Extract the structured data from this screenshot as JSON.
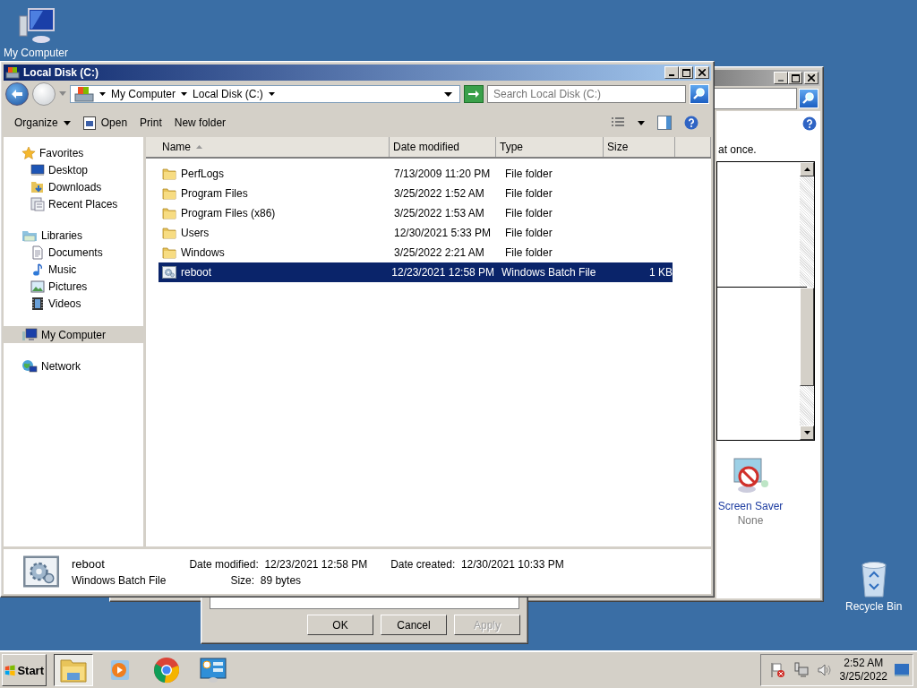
{
  "desktop_icons": [
    {
      "label": "My Computer"
    },
    {
      "label": "Recycle Bin"
    }
  ],
  "background_window": {
    "text_fragment": "at once.",
    "screen_saver": {
      "label": "Screen Saver",
      "value": "None"
    }
  },
  "dialog": {
    "buttons": [
      {
        "label": "OK",
        "disabled": false
      },
      {
        "label": "Cancel",
        "disabled": false
      },
      {
        "label": "Apply",
        "disabled": true
      }
    ]
  },
  "explorer": {
    "title": "Local Disk (C:)",
    "breadcrumbs": [
      "My Computer",
      "Local Disk (C:)"
    ],
    "search": {
      "placeholder": "Search Local Disk (C:)"
    },
    "toolbar": [
      {
        "label": "Organize",
        "kind": "menu"
      },
      {
        "label": "Open",
        "kind": "icon"
      },
      {
        "label": "Print",
        "kind": "plain"
      },
      {
        "label": "New folder",
        "kind": "plain"
      }
    ],
    "nav": [
      {
        "label": "Favorites",
        "selected": false,
        "children": [
          {
            "label": "Desktop",
            "selected": false
          },
          {
            "label": "Downloads",
            "selected": false
          },
          {
            "label": "Recent Places",
            "selected": false
          }
        ]
      },
      {
        "label": "Libraries",
        "selected": false,
        "children": [
          {
            "label": "Documents",
            "selected": false
          },
          {
            "label": "Music",
            "selected": false
          },
          {
            "label": "Pictures",
            "selected": false
          },
          {
            "label": "Videos",
            "selected": false
          }
        ]
      },
      {
        "label": "My Computer",
        "selected": true
      },
      {
        "label": "Network",
        "selected": false
      }
    ],
    "columns": [
      {
        "label": "Name",
        "sorted": true
      },
      {
        "label": "Date modified",
        "sorted": false
      },
      {
        "label": "Type",
        "sorted": false
      },
      {
        "label": "Size",
        "sorted": false
      }
    ],
    "rows": [
      {
        "name": "PerfLogs",
        "date": "7/13/2009 11:20 PM",
        "type": "File folder",
        "kind": "folder",
        "selected": false
      },
      {
        "name": "Program Files",
        "date": "3/25/2022 1:52 AM",
        "type": "File folder",
        "kind": "folder",
        "selected": false
      },
      {
        "name": "Program Files (x86)",
        "date": "3/25/2022 1:53 AM",
        "type": "File folder",
        "kind": "folder",
        "selected": false
      },
      {
        "name": "Users",
        "date": "12/30/2021 5:33 PM",
        "type": "File folder",
        "kind": "folder",
        "selected": false
      },
      {
        "name": "Windows",
        "date": "3/25/2022 2:21 AM",
        "type": "File folder",
        "kind": "folder",
        "selected": false
      },
      {
        "name": "reboot",
        "date": "12/23/2021 12:58 PM",
        "type": "Windows Batch File",
        "size": "1 KB",
        "kind": "batch",
        "selected": true
      }
    ],
    "details": {
      "name": "reboot",
      "type": "Windows Batch File",
      "modified_label": "Date modified:",
      "modified": "12/23/2021 12:58 PM",
      "created_label": "Date created:",
      "created": "12/30/2021 10:33 PM",
      "size_label": "Size:",
      "size": "89 bytes"
    }
  },
  "taskbar": {
    "start": "Start",
    "apps": [
      {
        "selected": true
      },
      {
        "selected": false
      },
      {
        "selected": false
      },
      {
        "selected": false
      }
    ],
    "time": "2:52 AM",
    "date": "3/25/2022"
  }
}
